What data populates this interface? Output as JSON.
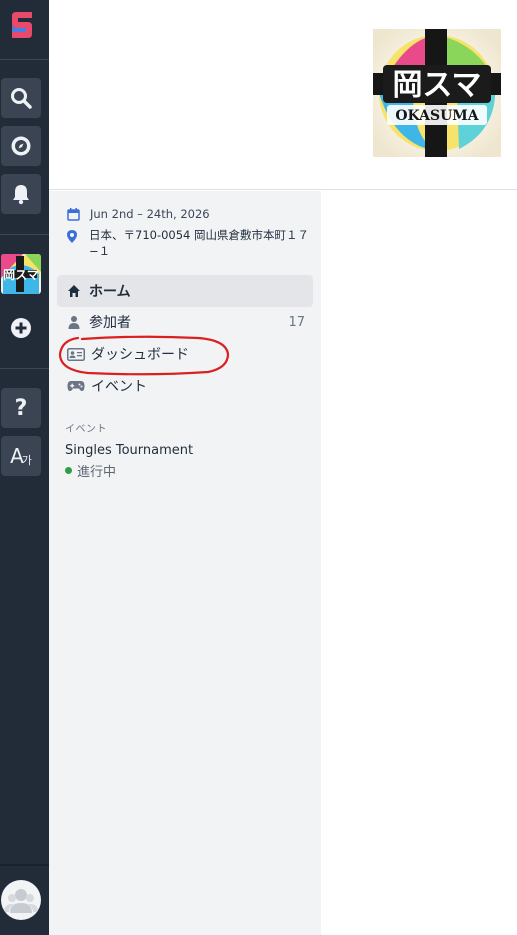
{
  "colors": {
    "rail_bg": "#222b38",
    "rail_button_bg": "#3a4452",
    "panel_bg": "#f2f3f5",
    "accent_blue": "#3b6fd6",
    "status_green": "#2e9e47",
    "annotation_red": "#d92121"
  },
  "rail": {
    "logo_icon": "brand-logo-icon",
    "buttons": [
      {
        "icon": "search-icon"
      },
      {
        "icon": "compass-icon"
      },
      {
        "icon": "bell-icon"
      },
      {
        "icon": "add-circle-icon"
      },
      {
        "icon": "help-icon"
      },
      {
        "icon": "language-icon"
      }
    ],
    "help_glyph": "?",
    "lang_glyph": "A",
    "lang_glyph_small": "가"
  },
  "event": {
    "logo_text": "岡スマ",
    "logo_subtext": "OKASUMA",
    "date": "Jun 2nd – 24th, 2026",
    "address": "日本、〒710-0054 岡山県倉敷市本町１７−１"
  },
  "nav": {
    "items": [
      {
        "label": "ホーム",
        "icon": "home-icon",
        "active": true
      },
      {
        "label": "参加者",
        "icon": "user-icon",
        "count": "17"
      },
      {
        "label": "ダッシュボード",
        "icon": "id-card-icon"
      },
      {
        "label": "イベント",
        "icon": "gamepad-icon"
      }
    ]
  },
  "events_section": {
    "heading": "イベント",
    "items": [
      {
        "name": "Singles Tournament",
        "status": "進行中"
      }
    ]
  }
}
